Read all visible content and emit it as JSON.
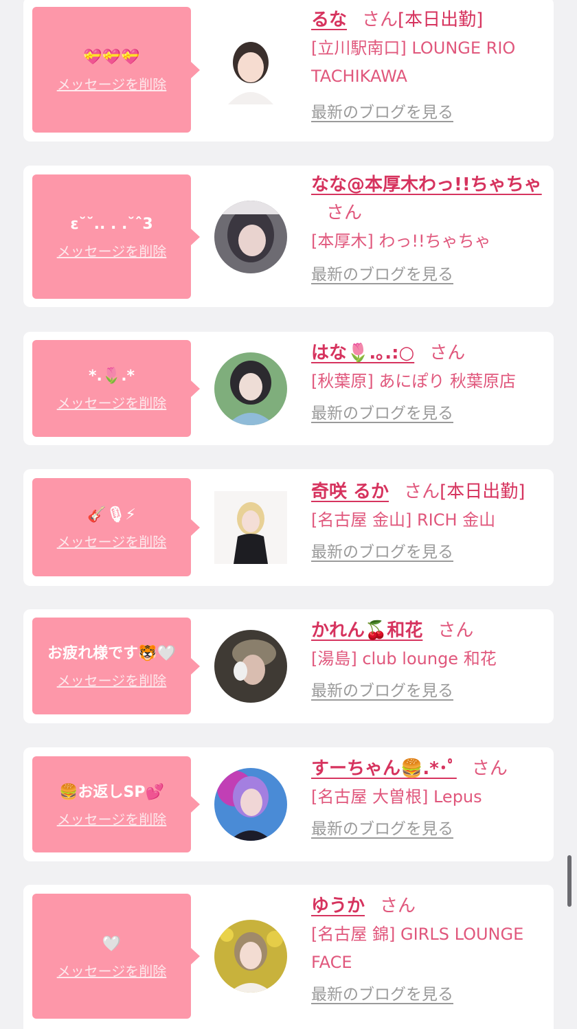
{
  "san_label": "さん",
  "delete_label": "メッセージを削除",
  "blog_label": "最新のブログを見る",
  "entries": [
    {
      "message": "💝💝💝",
      "name": "るな",
      "badge": "[本日出勤]",
      "store": "[立川駅南口] LOUNGE RIO TACHIKAWA"
    },
    {
      "message": "ε˘˘.. . .˘ˆ3",
      "name": "なな@本厚木わっ!!ちゃちゃ",
      "badge": "",
      "store": "[本厚木] わっ!!ちゃちゃ"
    },
    {
      "message": "*.🌷.*",
      "name": "はな🌷.｡.:○",
      "badge": "",
      "store": "[秋葉原] あにぽり 秋葉原店"
    },
    {
      "message": "🎸🎙⚡",
      "name": "奇咲 るか",
      "badge": "[本日出勤]",
      "store": "[名古屋 金山] RICH 金山"
    },
    {
      "message": "お疲れ様です🐯🤍",
      "name": "かれん🍒和花",
      "badge": "",
      "store": "[湯島] club lounge 和花"
    },
    {
      "message": "🍔お返しSP💕",
      "name": "すーちゃん🍔.*･ﾟ",
      "badge": "",
      "store": "[名古屋 大曽根] Lepus"
    },
    {
      "message": "🤍",
      "name": "ゆうか",
      "badge": "",
      "store": "[名古屋 錦] GIRLS LOUNGE FACE"
    }
  ]
}
